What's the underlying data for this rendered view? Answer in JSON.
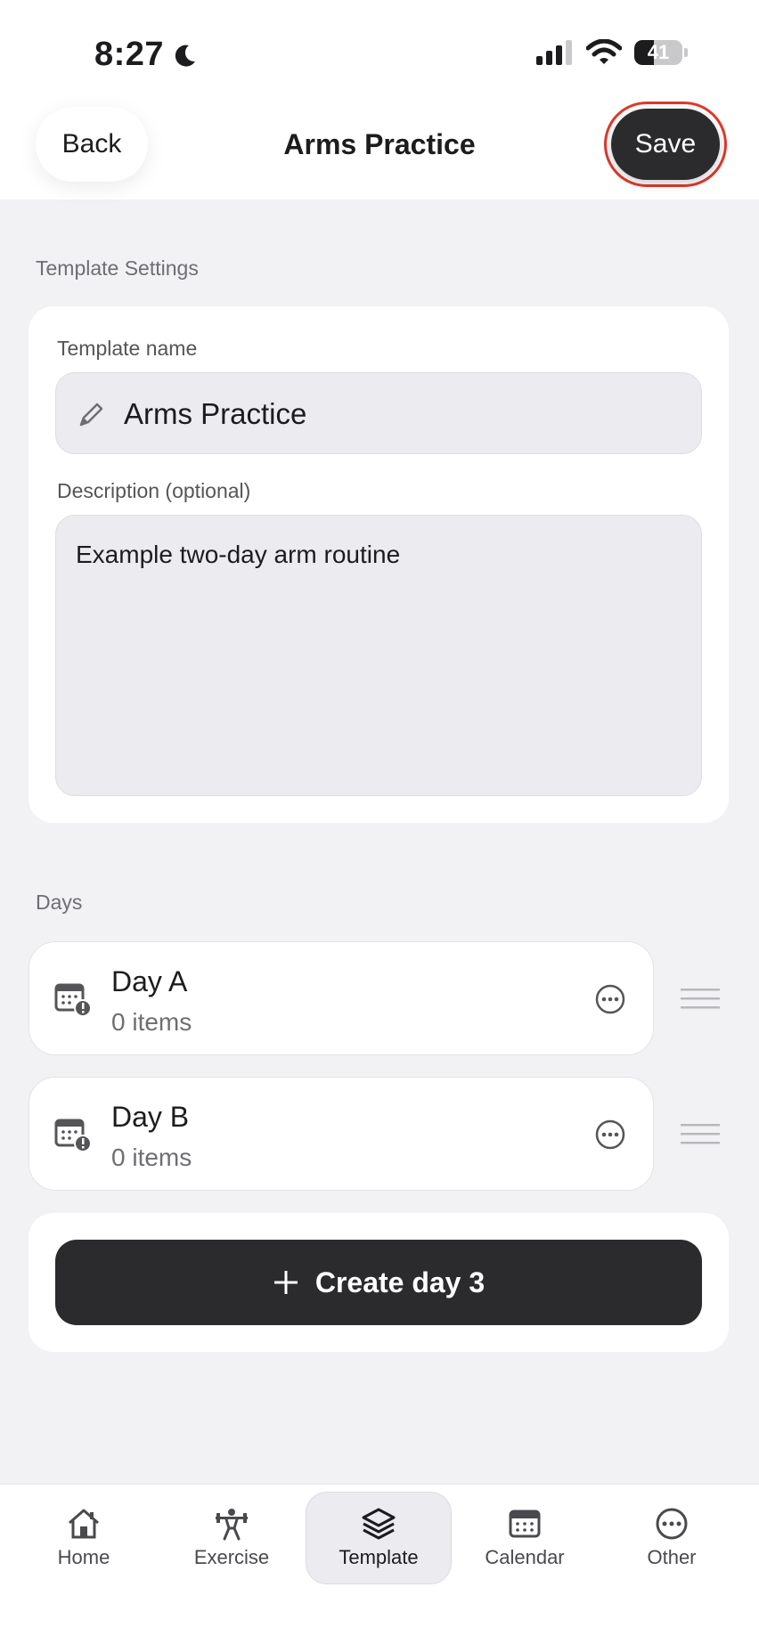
{
  "status_bar": {
    "time": "8:27",
    "battery": "41",
    "battery_level": 0.41
  },
  "header": {
    "back_label": "Back",
    "title": "Arms Practice",
    "save_label": "Save"
  },
  "template_settings": {
    "section_label": "Template Settings",
    "name_label": "Template name",
    "name_value": "Arms Practice",
    "description_label": "Description (optional)",
    "description_value": "Example two-day arm routine"
  },
  "days": {
    "section_label": "Days",
    "items": [
      {
        "title": "Day A",
        "subtitle": "0 items"
      },
      {
        "title": "Day B",
        "subtitle": "0 items"
      }
    ],
    "create_label": "Create day 3"
  },
  "tabs": [
    {
      "label": "Home",
      "icon": "home-icon"
    },
    {
      "label": "Exercise",
      "icon": "weightlifter-icon"
    },
    {
      "label": "Template",
      "icon": "layers-icon",
      "active": true
    },
    {
      "label": "Calendar",
      "icon": "calendar-icon"
    },
    {
      "label": "Other",
      "icon": "more-icon"
    }
  ],
  "colors": {
    "accent_dark": "#2b2b2d",
    "highlight_ring": "#e0392b",
    "background": "#f2f2f4"
  }
}
